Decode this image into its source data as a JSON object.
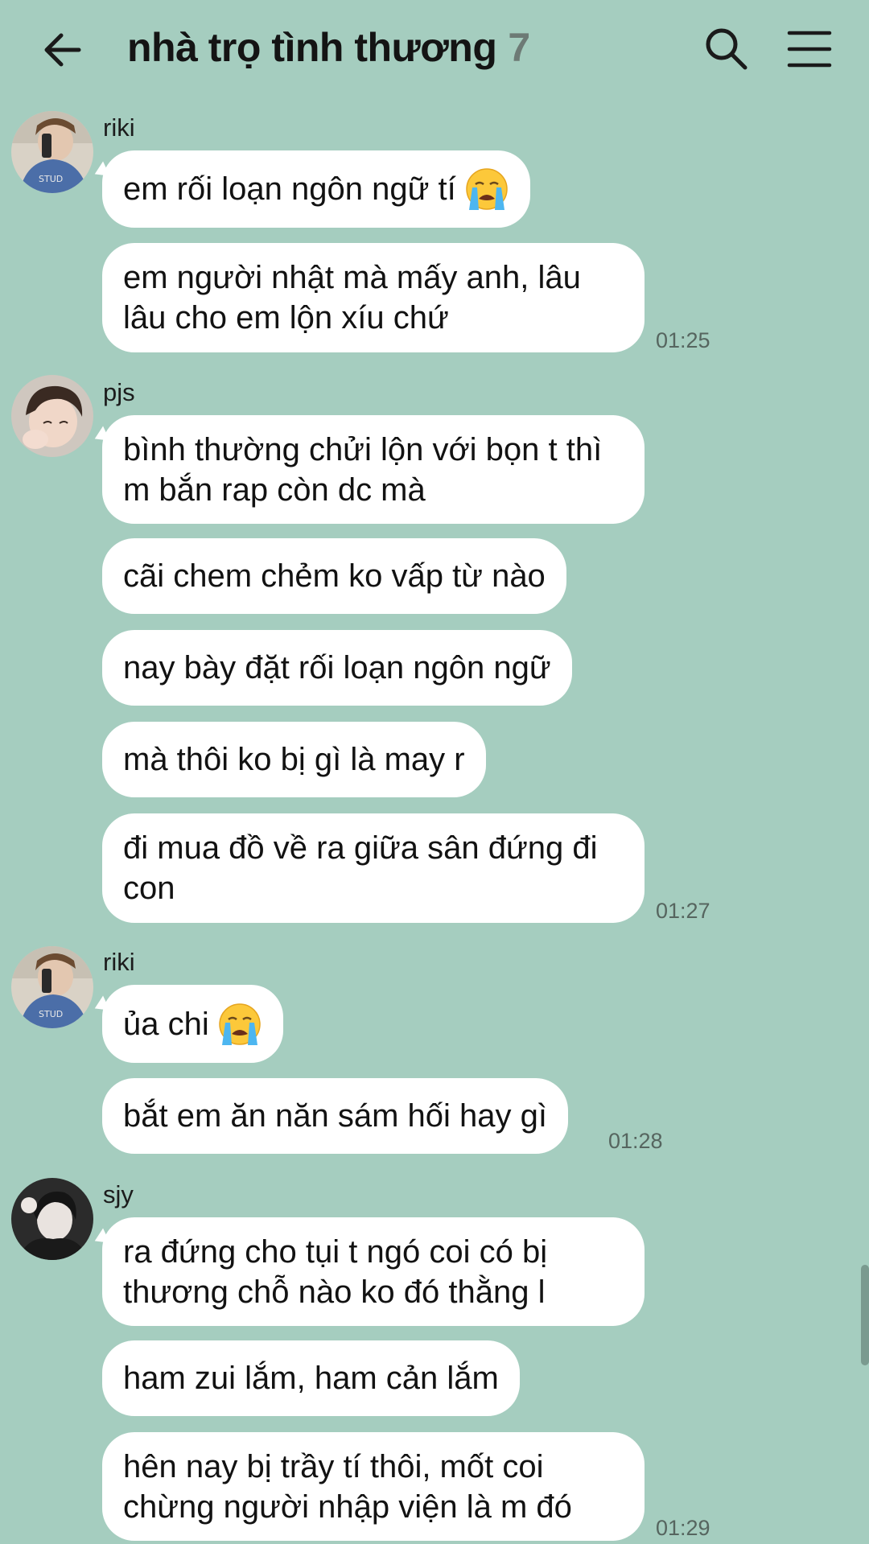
{
  "header": {
    "title": "nhà trọ tình thương",
    "member_count": "7",
    "back_icon": "arrow-left-icon",
    "search_icon": "search-icon",
    "menu_icon": "hamburger-menu-icon"
  },
  "messages": [
    {
      "sender": "riki",
      "text": "em rối loạn ngôn ngữ tí"
    },
    {
      "text": "em người nhật mà mấy anh, lâu lâu cho em lộn xíu chứ",
      "time": "01:25"
    },
    {
      "sender": "pjs",
      "text": "bình thường chửi lộn với bọn t thì m bắn rap còn dc mà"
    },
    {
      "text": "cãi chem chẻm ko vấp từ nào"
    },
    {
      "text": "nay bày đặt rối loạn ngôn ngữ"
    },
    {
      "text": "mà thôi ko bị gì là may r"
    },
    {
      "text": "đi mua đồ về ra giữa sân đứng đi con",
      "time": "01:27"
    },
    {
      "sender": "riki",
      "text": "ủa chi"
    },
    {
      "text": "bắt em ăn năn sám hối hay gì",
      "time": "01:28"
    },
    {
      "sender": "sjy",
      "text": "ra đứng cho tụi t ngó coi có bị thương chỗ nào ko đó thằng l"
    },
    {
      "text": "ham zui lắm, ham cản lắm"
    },
    {
      "text": "hên nay bị trầy tí thôi, mốt coi chừng người nhập viện là m đó",
      "time": "01:29"
    }
  ],
  "colors": {
    "background": "#a5cdbf",
    "bubble": "#ffffff",
    "time_text": "#56655f"
  }
}
